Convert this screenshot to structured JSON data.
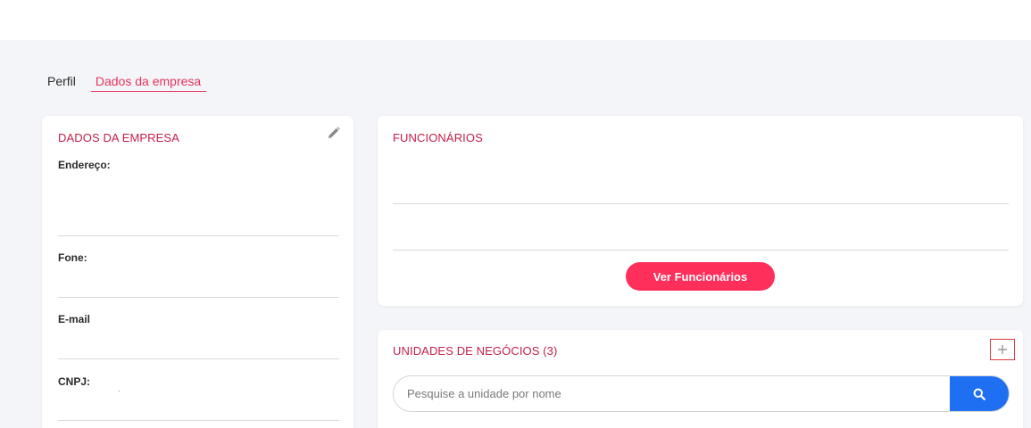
{
  "tabs": {
    "perfil": "Perfil",
    "empresa": "Dados da empresa"
  },
  "company_card": {
    "title": "DADOS DA EMPRESA",
    "fields": {
      "endereco": "Endereço:",
      "fone": "Fone:",
      "email": "E-mail",
      "cnpj": "CNPJ:"
    },
    "edit_icon": "pencil-icon"
  },
  "employees_card": {
    "title": "FUNCIONÁRIOS",
    "button_label": "Ver Funcionários"
  },
  "units_card": {
    "title": "UNIDADES DE NEGÓCIOS (3)",
    "add_icon": "plus-icon",
    "search_placeholder": "Pesquise a unidade por nome",
    "search_icon": "search-icon"
  },
  "colors": {
    "accent": "#e6335d",
    "title": "#c4204a",
    "button": "#ff2f5c",
    "search_button": "#1f6ff2",
    "background": "#f4f5f8"
  }
}
